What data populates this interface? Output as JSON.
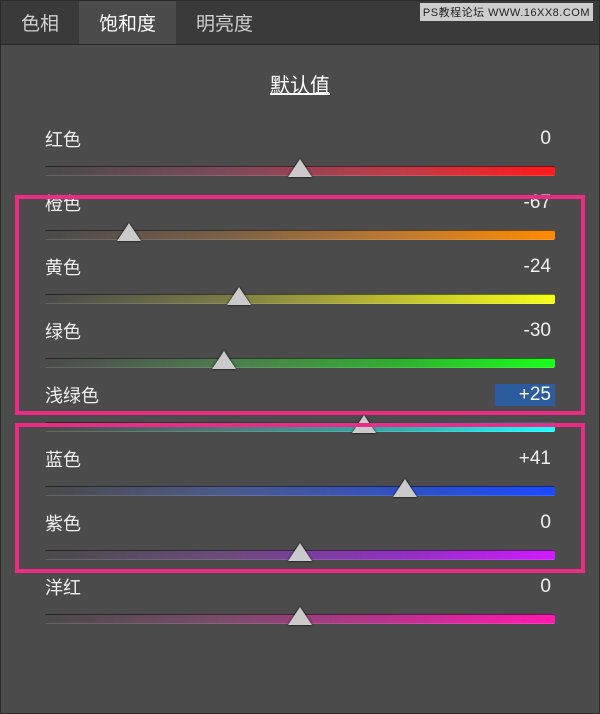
{
  "watermark": "PS教程论坛 WWW.16XX8.COM",
  "tabs": {
    "hue": "色相",
    "saturation": "饱和度",
    "luminance": "明亮度",
    "active": "saturation"
  },
  "defaults_label": "默认值",
  "sliders": [
    {
      "key": "red",
      "label": "红色",
      "value": "0",
      "pos": 50.0,
      "gradient": "g-red"
    },
    {
      "key": "orange",
      "label": "橙色",
      "value": "-67",
      "pos": 16.5,
      "gradient": "g-orange"
    },
    {
      "key": "yellow",
      "label": "黄色",
      "value": "-24",
      "pos": 38.0,
      "gradient": "g-yellow"
    },
    {
      "key": "green",
      "label": "绿色",
      "value": "-30",
      "pos": 35.0,
      "gradient": "g-green"
    },
    {
      "key": "aqua",
      "label": "浅绿色",
      "value": "+25",
      "pos": 62.5,
      "gradient": "g-aqua",
      "selected": true
    },
    {
      "key": "blue",
      "label": "蓝色",
      "value": "+41",
      "pos": 70.5,
      "gradient": "g-blue"
    },
    {
      "key": "purple",
      "label": "紫色",
      "value": "0",
      "pos": 50.0,
      "gradient": "g-purple"
    },
    {
      "key": "magenta",
      "label": "洋红",
      "value": "0",
      "pos": 50.0,
      "gradient": "g-magenta"
    }
  ]
}
